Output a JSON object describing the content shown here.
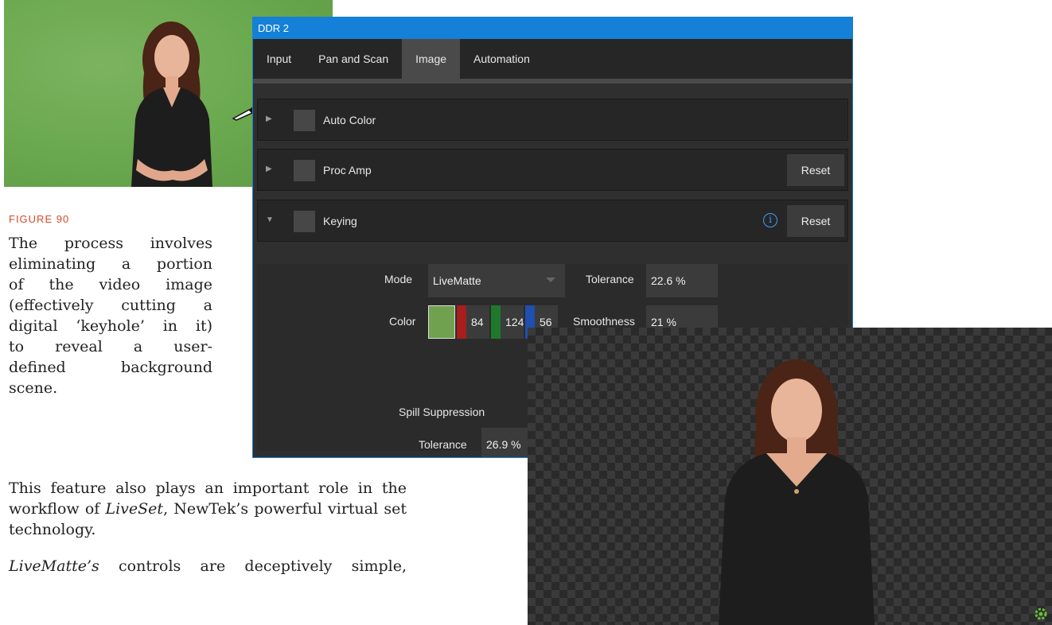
{
  "caption": "FIGURE 90",
  "paragraph1_lines": [
    "The process involves",
    "eliminating a portion",
    "of the video image",
    "(effectively cutting a",
    "digital ‘keyhole’ in it)",
    "to reveal a user-",
    "defined background",
    "scene."
  ],
  "paragraph2": {
    "before": "This feature also plays an important role in the workflow of ",
    "em": "LiveSet",
    "after": ", NewTek’s powerful virtual set technology."
  },
  "paragraph3": {
    "em": "LiveMatte’s",
    "after": " controls are deceptively simple,"
  },
  "ddr": {
    "title": "DDR 2",
    "tabs": [
      {
        "label": "Input",
        "active": false
      },
      {
        "label": "Pan and Scan",
        "active": false
      },
      {
        "label": "Image",
        "active": true
      },
      {
        "label": "Automation",
        "active": false
      }
    ],
    "sections": {
      "auto_color": {
        "label": "Auto Color"
      },
      "proc_amp": {
        "label": "Proc Amp",
        "reset": "Reset"
      },
      "keying": {
        "label": "Keying",
        "reset": "Reset"
      }
    },
    "keying": {
      "mode_label": "Mode",
      "mode_value": "LiveMatte",
      "color_label": "Color",
      "color_hex": "#6fa14e",
      "red": "84",
      "green": "124",
      "blue": "56",
      "tolerance_label": "Tolerance",
      "tolerance_value": "22.6 %",
      "smoothness_label": "Smoothness",
      "smoothness_value": "21 %",
      "spill_label": "Spill Suppression",
      "spill_tolerance_label": "Tolerance",
      "spill_tolerance_value": "26.9 %"
    }
  }
}
